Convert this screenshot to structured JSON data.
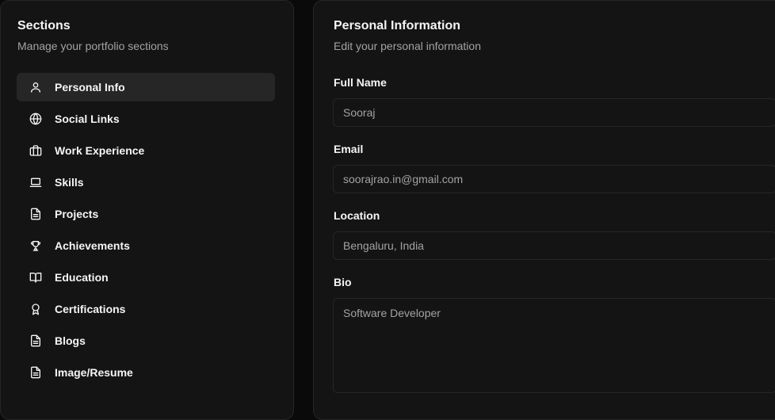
{
  "sidebar": {
    "title": "Sections",
    "subtitle": "Manage your portfolio sections",
    "items": [
      {
        "label": "Personal Info",
        "icon": "user-icon",
        "active": true
      },
      {
        "label": "Social Links",
        "icon": "globe-icon"
      },
      {
        "label": "Work Experience",
        "icon": "briefcase-icon"
      },
      {
        "label": "Skills",
        "icon": "laptop-icon"
      },
      {
        "label": "Projects",
        "icon": "file-text-icon"
      },
      {
        "label": "Achievements",
        "icon": "trophy-icon"
      },
      {
        "label": "Education",
        "icon": "book-open-icon"
      },
      {
        "label": "Certifications",
        "icon": "award-icon"
      },
      {
        "label": "Blogs",
        "icon": "file-text-icon"
      },
      {
        "label": "Image/Resume",
        "icon": "file-text-icon"
      }
    ]
  },
  "main": {
    "title": "Personal Information",
    "subtitle": "Edit your personal information",
    "fields": {
      "full_name": {
        "label": "Full Name",
        "value": "Sooraj"
      },
      "email": {
        "label": "Email",
        "value": "soorajrao.in@gmail.com"
      },
      "location": {
        "label": "Location",
        "value": "Bengaluru, India"
      },
      "bio": {
        "label": "Bio",
        "value": "Software Developer"
      }
    }
  },
  "colors": {
    "background": "#0a0a0a",
    "panel": "#141414",
    "border": "#262626",
    "active_item": "#262626",
    "text": "#f5f5f5",
    "muted_text": "#a3a3a3"
  }
}
